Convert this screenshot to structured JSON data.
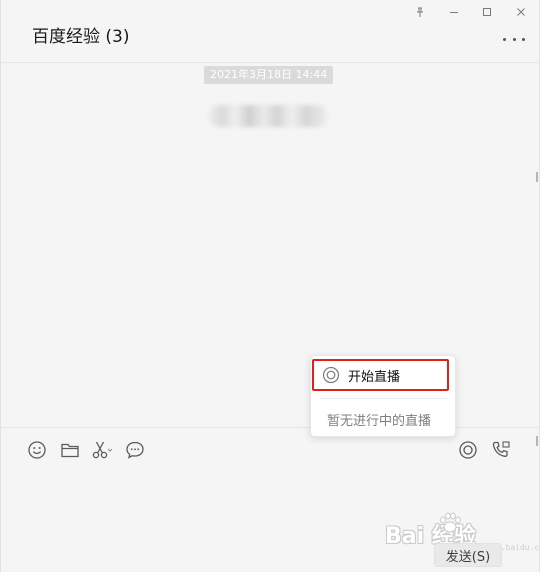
{
  "window": {
    "title": "百度经验 (3)",
    "pin_glyph": "⊥",
    "minimize_glyph": "—",
    "maximize_glyph": "□",
    "close_glyph": "✕"
  },
  "messages": {
    "timestamp": "2021年3月18日 14:44"
  },
  "toolbar": {
    "icons": [
      "emoji-icon",
      "folder-icon",
      "scissors-icon",
      "chat-history-icon",
      "live-icon",
      "call-icon"
    ]
  },
  "live_popup": {
    "start_label": "开始直播",
    "empty_label": "暂无进行中的直播"
  },
  "input": {
    "send_label": "发送(S)"
  },
  "watermark": {
    "brand": "Bai  经验",
    "sub": "jingyan.baidu.com"
  },
  "colors": {
    "highlight_border": "#e0201b",
    "background": "#f5f5f5"
  }
}
